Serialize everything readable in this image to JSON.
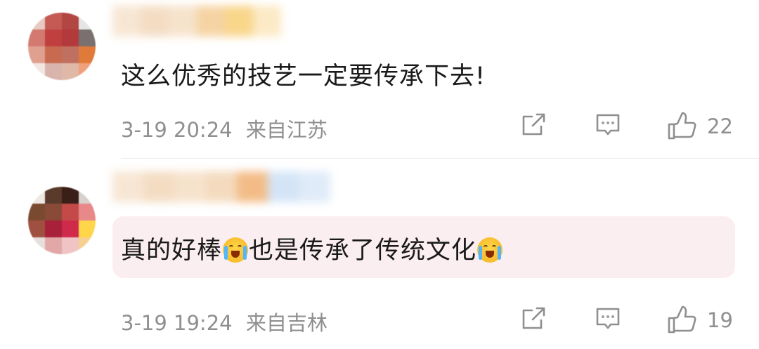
{
  "comments": [
    {
      "text": "这么优秀的技艺一定要传承下去!",
      "date": "3-19 20:24",
      "location": "来自江苏",
      "likes": "22",
      "highlighted": false,
      "avatar_colors": [
        "#e9c9c4",
        "#c55a55",
        "#b24643",
        "#e6e6e6",
        "#d37a70",
        "#c04040",
        "#b33a3a",
        "#7a7070",
        "#e0a090",
        "#c86a50",
        "#c07060",
        "#e07a3a",
        "#f2e6e2",
        "#d8b4ac",
        "#e0b8a8",
        "#f0a07a"
      ],
      "username_colors": [
        "#f6e4cf",
        "#f3d9bd",
        "#f6e0c7",
        "#f5cf9a",
        "#f8d27e",
        "#fce7bf"
      ]
    },
    {
      "text_parts": [
        "真的好棒",
        "也是传承了传统文化"
      ],
      "emojis": [
        "crying-laughing-emoji",
        "crying-laughing-emoji"
      ],
      "date": "3-19 19:24",
      "location": "来自吉林",
      "likes": "19",
      "highlighted": true,
      "avatar_colors": [
        "#efe7e2",
        "#5a3a2a",
        "#3a1e18",
        "#d8d0cc",
        "#7a4a30",
        "#8a4a38",
        "#c44a4a",
        "#e88888",
        "#a05040",
        "#a8203a",
        "#d02a4a",
        "#ffd54a",
        "#e7dfdb",
        "#e2a8a8",
        "#f0c4c4",
        "#f5d090"
      ],
      "username_colors": [
        "#f6e4cf",
        "#f3d9bd",
        "#f6e0c7",
        "#f3d7b8",
        "#f2b57a",
        "#cfe2f6",
        "#dce9f8"
      ]
    }
  ],
  "icons": {
    "share": "share-icon",
    "reply": "comment-icon",
    "like": "thumbs-up-icon"
  },
  "colors": {
    "text": "#1a1a1a",
    "meta": "#8f8f8f",
    "highlight": "#fbeef0",
    "divider": "#ececec"
  }
}
